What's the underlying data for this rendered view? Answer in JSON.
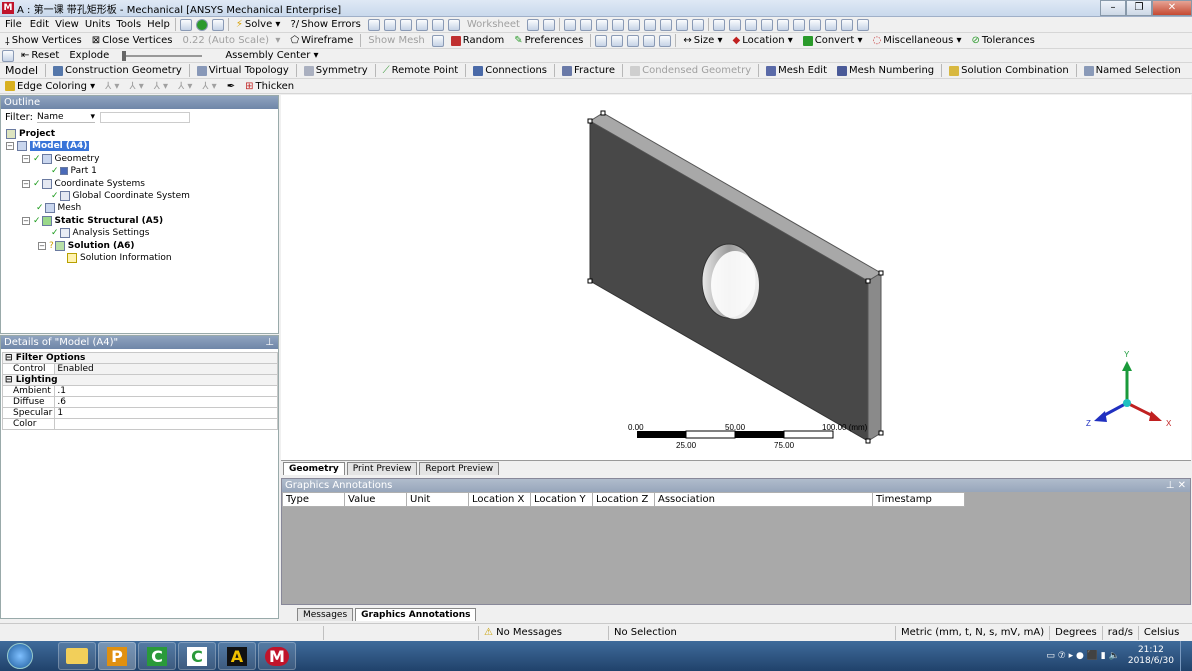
{
  "window": {
    "title": "A : 第一课 带孔矩形板 - Mechanical [ANSYS Mechanical Enterprise]",
    "logo": "M"
  },
  "menu": [
    "File",
    "Edit",
    "View",
    "Units",
    "Tools",
    "Help"
  ],
  "toolbar1": {
    "solve": "Solve",
    "show_errors": "Show Errors",
    "worksheet": "Worksheet"
  },
  "toolbar2": {
    "show_vertices": "Show Vertices",
    "close_vertices": "Close Vertices",
    "auto_scale": "0.22 (Auto Scale)",
    "wireframe": "Wireframe",
    "show_mesh": "Show Mesh",
    "random": "Random",
    "preferences": "Preferences",
    "size": "Size",
    "location": "Location",
    "convert": "Convert",
    "misc": "Miscellaneous",
    "tolerances": "Tolerances"
  },
  "toolbar3": {
    "reset": "Reset",
    "explode": "Explode",
    "assembly_center": "Assembly Center"
  },
  "context": [
    "Model",
    "Construction Geometry",
    "Virtual Topology",
    "Symmetry",
    "Remote Point",
    "Connections",
    "Fracture",
    "Condensed Geometry",
    "Mesh Edit",
    "Mesh Numbering",
    "Solution Combination",
    "Named Selection"
  ],
  "toolbar5": {
    "edge_coloring": "Edge Coloring",
    "thicken": "Thicken"
  },
  "outline": {
    "title": "Outline",
    "filter_label": "Filter:",
    "filter_value": "Name",
    "items": [
      "Project",
      "Model (A4)",
      "Geometry",
      "Part 1",
      "Coordinate Systems",
      "Global Coordinate System",
      "Mesh",
      "Static Structural (A5)",
      "Analysis Settings",
      "Solution (A6)",
      "Solution Information"
    ]
  },
  "details": {
    "title": "Details of \"Model (A4)\"",
    "rows": [
      {
        "group": "Filter Options"
      },
      {
        "k": "Control",
        "v": "Enabled"
      },
      {
        "group": "Lighting"
      },
      {
        "k": "Ambient",
        "v": ".1"
      },
      {
        "k": "Diffuse",
        "v": ".6"
      },
      {
        "k": "Specular",
        "v": "1"
      },
      {
        "k": "Color",
        "v": ""
      }
    ]
  },
  "scale": {
    "t0": "0.00",
    "t1": "50.00",
    "t2": "100.00 (mm)",
    "b1": "25.00",
    "b2": "75.00"
  },
  "triad": {
    "x": "X",
    "y": "Y",
    "z": "Z"
  },
  "view_tabs": [
    "Geometry",
    "Print Preview",
    "Report Preview"
  ],
  "annotations": {
    "title": "Graphics Annotations",
    "columns": [
      "Type",
      "Value",
      "Unit",
      "Location X",
      "Location Y",
      "Location Z",
      "Association",
      "Timestamp"
    ]
  },
  "bottom_tabs": [
    "Messages",
    "Graphics Annotations"
  ],
  "status": {
    "messages": "No Messages",
    "selection": "No Selection",
    "units": "Metric (mm, t, N, s, mV, mA)",
    "degrees": "Degrees",
    "rads": "rad/s",
    "temp": "Celsius"
  },
  "taskbar": {
    "time": "21:12",
    "date": "2018/6/30",
    "apps": [
      "P",
      "C",
      "C",
      "A",
      "M"
    ]
  }
}
